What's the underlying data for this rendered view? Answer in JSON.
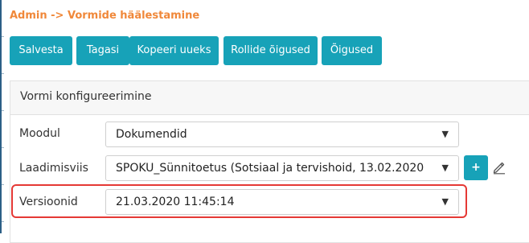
{
  "breadcrumb": "Admin -> Vormide häälestamine",
  "toolbar": {
    "save_label": "Salvesta",
    "back_label": "Tagasi",
    "copy_label": "Kopeeri uueks",
    "role_rights_label": "Rollide õigused",
    "rights_label": "Õigused"
  },
  "panel": {
    "title": "Vormi konfigureerimine"
  },
  "form": {
    "module": {
      "label": "Moodul",
      "value": "Dokumendid"
    },
    "load_method": {
      "label": "Laadimisviis",
      "value": "SPOKU_Sünnitoetus (Sotsiaal ja tervishoid, 13.02.2020"
    },
    "versions": {
      "label": "Versioonid",
      "value": "21.03.2020 11:45:14"
    }
  },
  "icons": {
    "plus": "+",
    "dropdown": "▼"
  },
  "colors": {
    "accent": "#17a2b8",
    "breadcrumb": "#f0883a",
    "highlight": "#e53935"
  }
}
